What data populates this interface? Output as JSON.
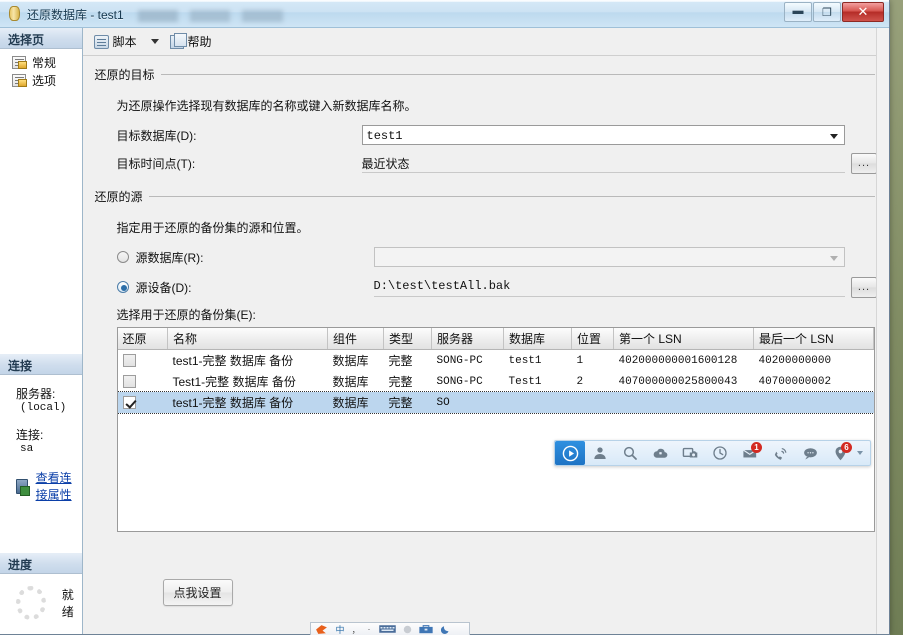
{
  "window": {
    "title": "还原数据库 - test1",
    "icon": "database-icon",
    "controls": {
      "minimize": "—",
      "maximize": "❐",
      "close": "✕"
    }
  },
  "sidebar": {
    "select_page_header": "选择页",
    "pages": [
      {
        "label": "常规",
        "icon": "page-icon",
        "selected": false
      },
      {
        "label": "选项",
        "icon": "page-icon",
        "selected": false
      }
    ],
    "connection": {
      "header": "连接",
      "server_label": "服务器:",
      "server_value": "(local)",
      "connection_label": "连接:",
      "connection_value": "sa",
      "view_properties_link": "查看连接属性",
      "link_icon": "connection-properties-icon"
    },
    "progress": {
      "header": "进度",
      "status": "就绪",
      "spinner_icon": "progress-spinner-icon"
    }
  },
  "toolbar": {
    "script_label": "脚本",
    "script_icon": "script-icon",
    "script_caret_icon": "chevron-down-icon",
    "help_label": "帮助",
    "help_icon": "help-icon"
  },
  "destination": {
    "group_title": "还原的目标",
    "description": "为还原操作选择现有数据库的名称或键入新数据库名称。",
    "target_db_label": "目标数据库(D):",
    "target_db_value": "test1",
    "target_time_label": "目标时间点(T):",
    "target_time_value": "最近状态",
    "browse_button": "...",
    "dropdown_icon": "chevron-down-icon"
  },
  "source": {
    "group_title": "还原的源",
    "description": "指定用于还原的备份集的源和位置。",
    "source_db_label": "源数据库(R):",
    "source_db_value": "",
    "source_db_selected": false,
    "source_device_label": "源设备(D):",
    "source_device_value": "D:\\test\\testAll.bak",
    "source_device_selected": true,
    "browse_button": "...",
    "backupset_label": "选择用于还原的备份集(E):"
  },
  "grid": {
    "columns": [
      "还原",
      "名称",
      "组件",
      "类型",
      "服务器",
      "数据库",
      "位置",
      "第一个 LSN",
      "最后一个 LSN"
    ],
    "rows": [
      {
        "restore": false,
        "name": "test1-完整 数据库 备份",
        "component": "数据库",
        "type": "完整",
        "server": "SONG-PC",
        "database": "test1",
        "position": "1",
        "first_lsn": "402000000001600128",
        "last_lsn": "40200000000",
        "selected": false
      },
      {
        "restore": false,
        "name": "Test1-完整 数据库 备份",
        "component": "数据库",
        "type": "完整",
        "server": "SONG-PC",
        "database": "Test1",
        "position": "2",
        "first_lsn": "407000000025800043",
        "last_lsn": "40700000002",
        "selected": false
      },
      {
        "restore": true,
        "name": "test1-完整 数据库 备份",
        "component": "数据库",
        "type": "完整",
        "server": "SO",
        "database": "",
        "position": "",
        "first_lsn": "",
        "last_lsn": "",
        "selected": true
      }
    ]
  },
  "settings_button": {
    "label": "点我设置"
  },
  "float_toolbar": {
    "items": [
      {
        "icon": "play-circle-icon",
        "active": true,
        "badge": ""
      },
      {
        "icon": "user-icon",
        "active": false,
        "badge": ""
      },
      {
        "icon": "search-icon",
        "active": false,
        "badge": ""
      },
      {
        "icon": "cloud-icon",
        "active": false,
        "badge": ""
      },
      {
        "icon": "screenshot-camera-icon",
        "active": false,
        "badge": ""
      },
      {
        "icon": "clock-icon",
        "active": false,
        "badge": ""
      },
      {
        "icon": "mail-icon",
        "active": false,
        "badge": "1"
      },
      {
        "icon": "phone-signal-icon",
        "active": false,
        "badge": ""
      },
      {
        "icon": "chat-bubble-icon",
        "active": false,
        "badge": ""
      },
      {
        "icon": "location-pin-icon",
        "active": false,
        "badge": "6"
      }
    ],
    "expand_icon": "chevron-down-icon"
  },
  "ime_bar": {
    "items": [
      "ime-logo-icon",
      "chinese-mode-icon",
      "punctuation-icon",
      "dot-icon",
      "keyboard-icon",
      "circle-icon",
      "toolbox-icon",
      "moon-icon"
    ]
  },
  "colors": {
    "accent_blue": "#2f90e0",
    "title_blue": "#cce2f3",
    "selection_blue": "#bcd6ee",
    "badge_red": "#d32a22",
    "link_blue": "#0b3fa8",
    "close_red": "#b52c27"
  }
}
